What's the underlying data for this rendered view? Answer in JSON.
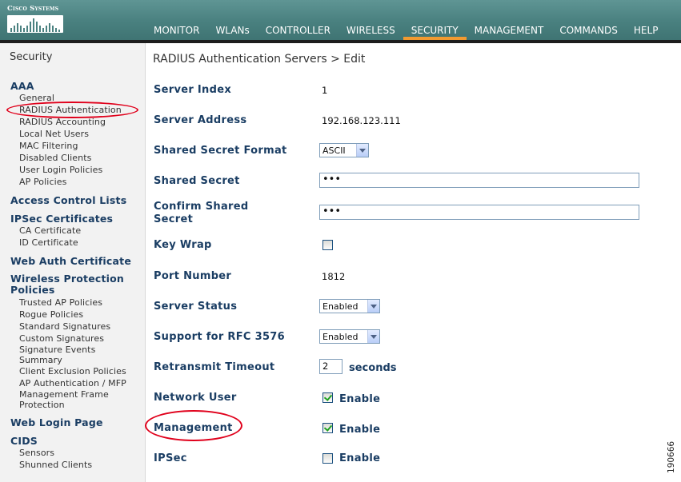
{
  "brand": {
    "name": "Cisco Systems",
    "icon": "cisco-bridge-logo"
  },
  "topnav": [
    {
      "label": "MONITOR",
      "active": false
    },
    {
      "label": "WLANs",
      "active": false
    },
    {
      "label": "CONTROLLER",
      "active": false
    },
    {
      "label": "WIRELESS",
      "active": false
    },
    {
      "label": "SECURITY",
      "active": true
    },
    {
      "label": "MANAGEMENT",
      "active": false
    },
    {
      "label": "COMMANDS",
      "active": false
    },
    {
      "label": "HELP",
      "active": false
    }
  ],
  "sidebar": {
    "title": "Security",
    "sections": {
      "aaa": {
        "label": "AAA",
        "items": [
          "General",
          "RADIUS Authentication",
          "RADIUS Accounting",
          "Local Net Users",
          "MAC Filtering",
          "Disabled Clients",
          "User Login Policies",
          "AP Policies"
        ]
      },
      "acl": {
        "label": "Access Control Lists"
      },
      "ipsec": {
        "label": "IPSec Certificates",
        "items": [
          "CA Certificate",
          "ID Certificate"
        ]
      },
      "webauth": {
        "label": "Web Auth Certificate"
      },
      "wpp": {
        "label": "Wireless Protection Policies",
        "items": [
          "Trusted AP Policies",
          "Rogue Policies",
          "Standard Signatures",
          "Custom Signatures",
          "Signature Events Summary",
          "Client Exclusion Policies",
          "AP Authentication / MFP",
          "Management Frame Protection"
        ]
      },
      "weblogin": {
        "label": "Web Login Page"
      },
      "cids": {
        "label": "CIDS",
        "items": [
          "Sensors",
          "Shunned Clients"
        ]
      }
    }
  },
  "main": {
    "title": "RADIUS Authentication Servers > Edit",
    "fields": {
      "server_index": {
        "label": "Server Index",
        "value": "1"
      },
      "server_address": {
        "label": "Server Address",
        "value": "192.168.123.111"
      },
      "secret_format": {
        "label": "Shared Secret Format",
        "value": "ASCII"
      },
      "shared_secret": {
        "label": "Shared Secret",
        "value": "•••"
      },
      "confirm_secret": {
        "label": "Confirm Shared Secret",
        "value": "•••"
      },
      "key_wrap": {
        "label": "Key Wrap",
        "checked": false
      },
      "port_number": {
        "label": "Port Number",
        "value": "1812"
      },
      "server_status": {
        "label": "Server Status",
        "value": "Enabled"
      },
      "rfc3576": {
        "label": "Support for RFC 3576",
        "value": "Enabled"
      },
      "retransmit": {
        "label": "Retransmit Timeout",
        "value": "2",
        "suffix": "seconds"
      },
      "network_user": {
        "label": "Network User",
        "checked": true,
        "option": "Enable"
      },
      "management": {
        "label": "Management",
        "checked": true,
        "option": "Enable"
      },
      "ipsec": {
        "label": "IPSec",
        "checked": false,
        "option": "Enable"
      }
    }
  },
  "figure_id": "190666",
  "colors": {
    "header": "#4a8180",
    "active_tab": "#f29a30",
    "label": "#1a3d63",
    "annotation": "#e0001b"
  }
}
